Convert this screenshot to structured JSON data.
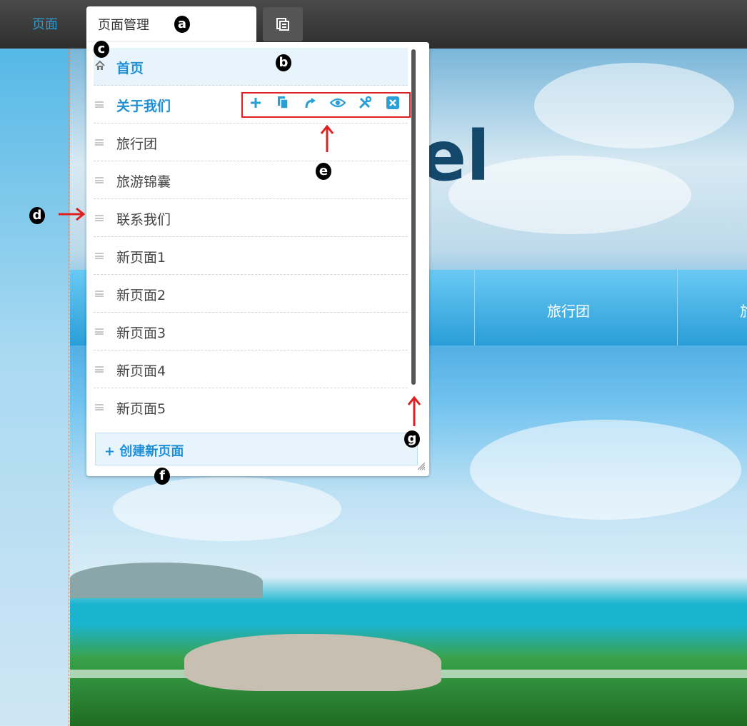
{
  "topbar": {
    "page_link": "页面",
    "tab_label": "页面管理"
  },
  "background": {
    "hero_text": "el",
    "nav_items": [
      "旅行团",
      "旅"
    ]
  },
  "panel": {
    "pages": [
      {
        "label": "首页",
        "type": "home"
      },
      {
        "label": "关于我们",
        "type": "page",
        "active": true
      },
      {
        "label": "旅行团",
        "type": "page"
      },
      {
        "label": "旅游锦囊",
        "type": "page"
      },
      {
        "label": "联系我们",
        "type": "page"
      },
      {
        "label": "新页面1",
        "type": "page"
      },
      {
        "label": "新页面2",
        "type": "page"
      },
      {
        "label": "新页面3",
        "type": "page"
      },
      {
        "label": "新页面4",
        "type": "page"
      },
      {
        "label": "新页面5",
        "type": "page"
      }
    ],
    "row_actions": [
      "plus-icon",
      "copy-icon",
      "redirect-icon",
      "eye-icon",
      "settings-icon",
      "delete-icon"
    ],
    "create_button": "创建新页面"
  },
  "annotations": {
    "a": "a",
    "b": "b",
    "c": "c",
    "d": "d",
    "e": "e",
    "f": "f",
    "g": "g"
  },
  "colors": {
    "accent": "#1d8fd6",
    "annotation": "#e02020",
    "topbar": "#3a3a3a"
  }
}
